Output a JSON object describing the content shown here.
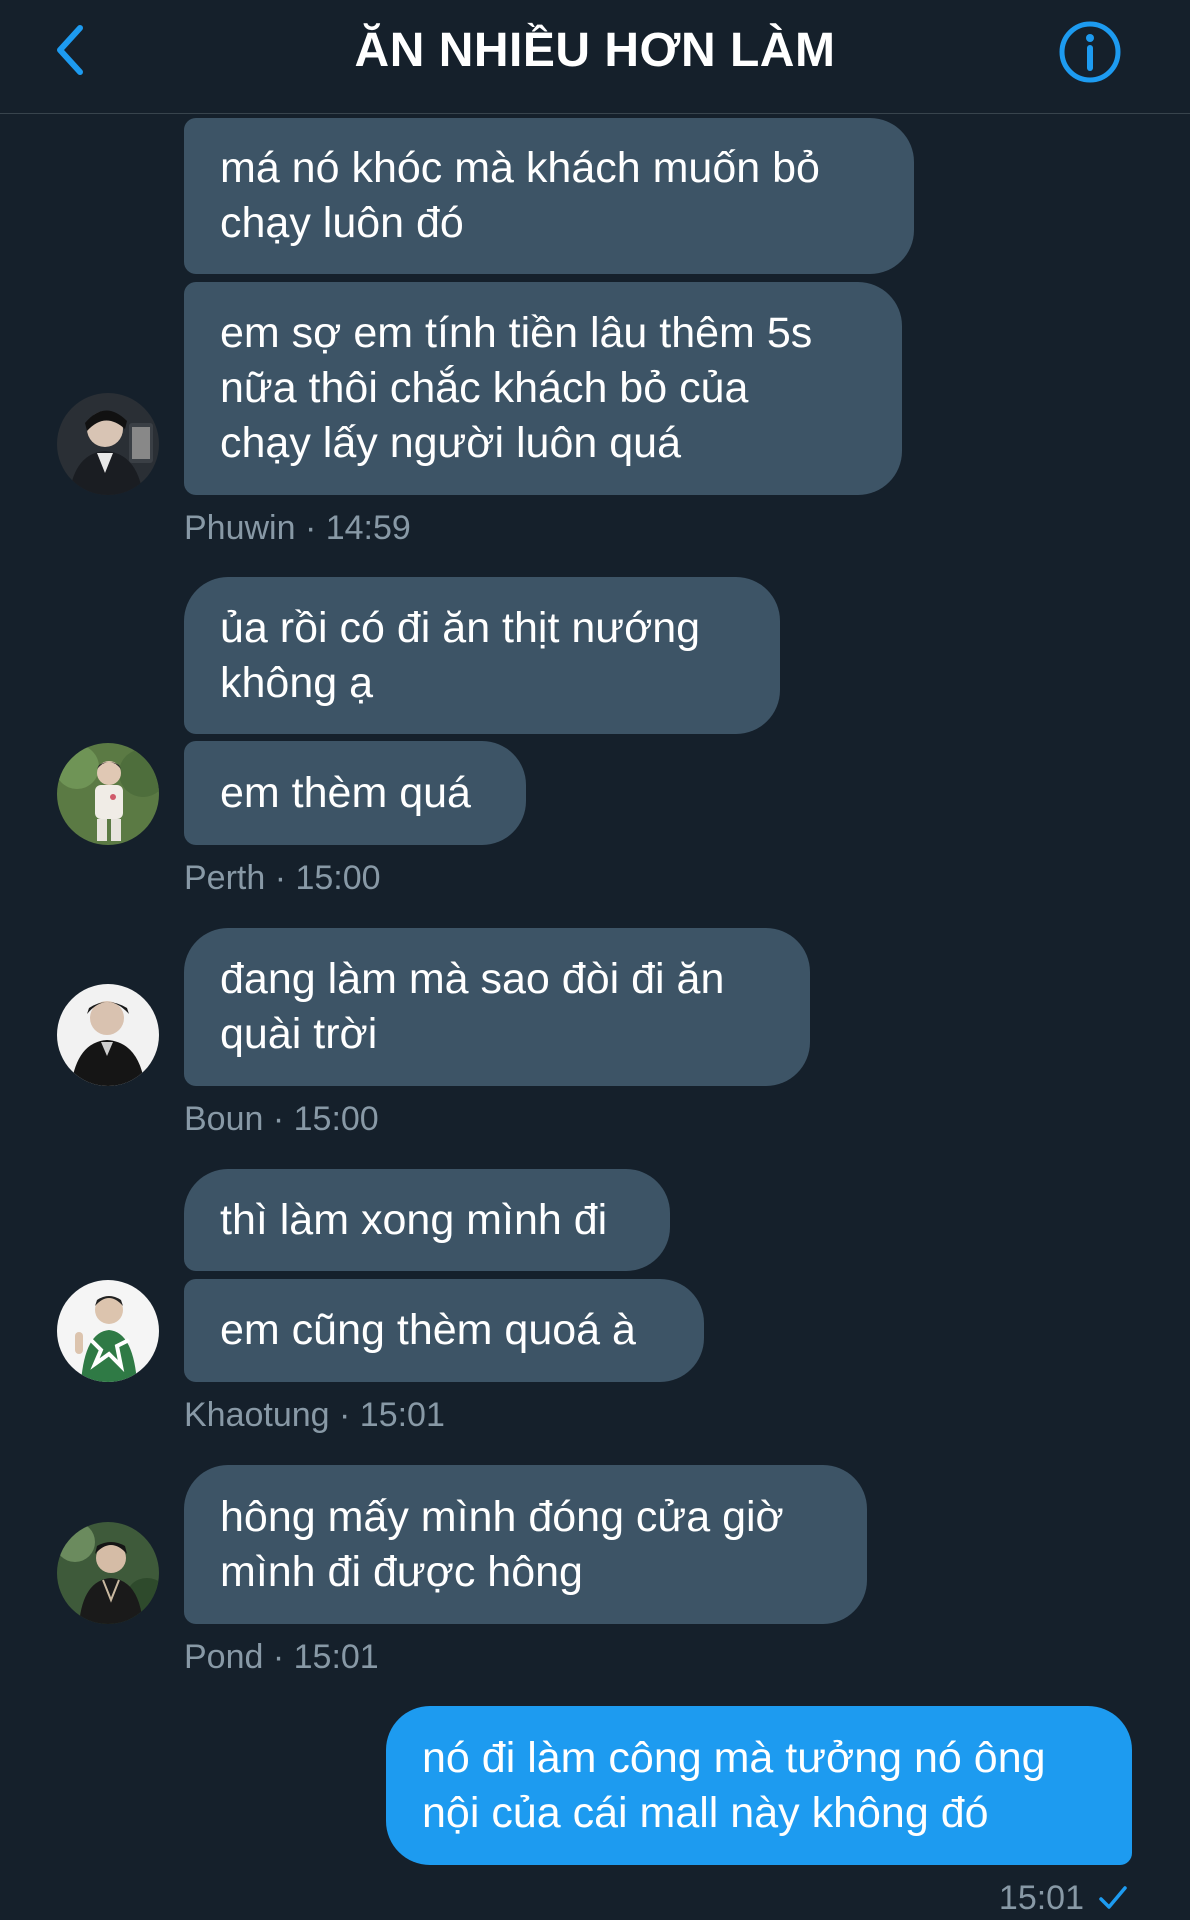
{
  "header": {
    "title": "ĂN NHIỀU HƠN LÀM",
    "back_icon": "chevron-left-icon",
    "info_icon": "info-icon",
    "accent_color": "#1d9bf0"
  },
  "messages": [
    {
      "sender": "Phuwin",
      "time": "14:59",
      "meta": "Phuwin · 14:59",
      "bubbles": [
        "má nó khóc mà khách muốn bỏ\nchạy luôn đó",
        "em sợ em tính tiền lâu thêm 5s\nnữa thôi chắc khách bỏ của\nchạy lấy người luôn quá"
      ]
    },
    {
      "sender": "Perth",
      "time": "15:00",
      "meta": "Perth · 15:00",
      "bubbles": [
        "ủa rồi có đi ăn thịt nướng\nkhông ạ",
        "em thèm quá"
      ]
    },
    {
      "sender": "Boun",
      "time": "15:00",
      "meta": "Boun · 15:00",
      "bubbles": [
        "đang làm mà sao đòi đi ăn\nquài trời"
      ]
    },
    {
      "sender": "Khaotung",
      "time": "15:01",
      "meta": "Khaotung · 15:01",
      "bubbles": [
        "thì làm xong mình đi",
        "em cũng thèm quoá à"
      ]
    },
    {
      "sender": "Pond",
      "time": "15:01",
      "meta": "Pond · 15:01",
      "bubbles": [
        "hông mấy mình đóng cửa giờ\nmình đi được hông"
      ]
    }
  ],
  "my_message": {
    "text": "nó đi làm công mà tưởng nó ông\nnội của cái mall này không đó",
    "time": "15:01",
    "status_icon": "check-icon"
  }
}
